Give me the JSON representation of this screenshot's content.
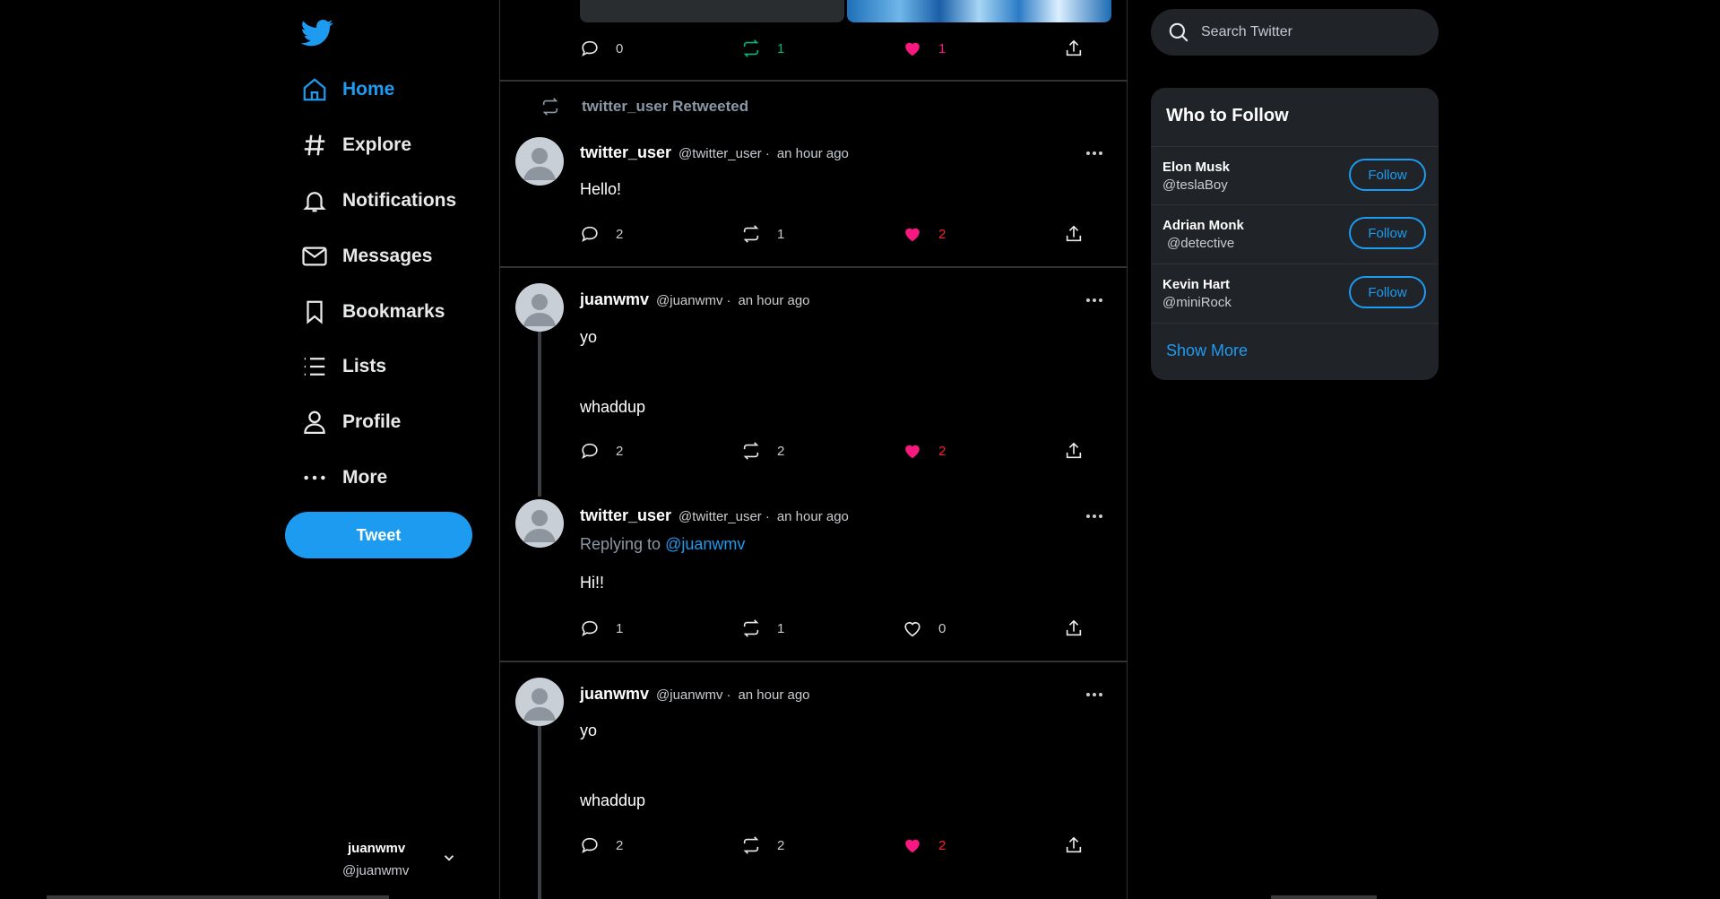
{
  "nav": {
    "items": [
      {
        "label": "Home",
        "icon": "home-icon",
        "active": true
      },
      {
        "label": "Explore",
        "icon": "hashtag-icon"
      },
      {
        "label": "Notifications",
        "icon": "bell-icon"
      },
      {
        "label": "Messages",
        "icon": "envelope-icon"
      },
      {
        "label": "Bookmarks",
        "icon": "bookmark-icon"
      },
      {
        "label": "Lists",
        "icon": "list-icon"
      },
      {
        "label": "Profile",
        "icon": "person-icon"
      },
      {
        "label": "More",
        "icon": "ellipsis-icon"
      }
    ],
    "tweet_button": "Tweet",
    "account": {
      "name": "juanwmv",
      "handle": "@juanwmv"
    }
  },
  "feed": {
    "top_tweet_actions": {
      "replies": "0",
      "retweets": "1",
      "likes": "1"
    },
    "retweet_label": "twitter_user Retweeted",
    "tweets": [
      {
        "name": "twitter_user",
        "handle": "@twitter_user",
        "dot": "·",
        "time": "an hour ago",
        "text": "Hello!",
        "replies": "2",
        "retweets": "1",
        "likes": "2",
        "liked": true
      },
      {
        "name": "juanwmv",
        "handle": "@juanwmv",
        "dot": "·",
        "time": "an hour ago",
        "text_line1": "yo",
        "text_line2": "whaddup",
        "replies": "2",
        "retweets": "2",
        "likes": "2",
        "liked": true
      },
      {
        "name": "twitter_user",
        "handle": "@twitter_user",
        "dot": "·",
        "time": "an hour ago",
        "replying_prefix": "Replying to",
        "replying_to": "@juanwmv",
        "text": "Hi!!",
        "replies": "1",
        "retweets": "1",
        "likes": "0",
        "liked": false
      },
      {
        "name": "juanwmv",
        "handle": "@juanwmv",
        "dot": "·",
        "time": "an hour ago",
        "text_line1": "yo",
        "text_line2": "whaddup",
        "replies": "2",
        "retweets": "2",
        "likes": "2",
        "liked": true
      }
    ]
  },
  "search": {
    "placeholder": "Search Twitter"
  },
  "who_to_follow": {
    "title": "Who to Follow",
    "users": [
      {
        "name": "Elon Musk",
        "handle": "@teslaBoy",
        "button": "Follow"
      },
      {
        "name": "Adrian Monk",
        "handle": "@detective",
        "button": "Follow"
      },
      {
        "name": "Kevin Hart",
        "handle": "@miniRock",
        "button": "Follow"
      }
    ],
    "show_more": "Show More"
  },
  "colors": {
    "accent": "#1d9bf0",
    "like": "#f91880",
    "retweet_active": "#00ba7c",
    "background": "#000000",
    "card": "#202327"
  }
}
